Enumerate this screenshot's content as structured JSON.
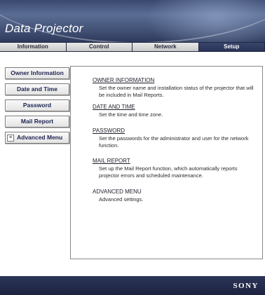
{
  "header": {
    "app_title": "Data Projector"
  },
  "tabs": [
    {
      "label": "Information"
    },
    {
      "label": "Control"
    },
    {
      "label": "Network"
    },
    {
      "label": "Setup"
    }
  ],
  "sidebar": {
    "items": [
      {
        "label": "Owner Information"
      },
      {
        "label": "Date and Time"
      },
      {
        "label": "Password"
      },
      {
        "label": "Mail Report"
      },
      {
        "label": "Advanced Menu",
        "icon": "collapse-icon",
        "icon_glyph": "≡"
      }
    ]
  },
  "main": {
    "sections": [
      {
        "title": "OWNER INFORMATION",
        "description": "Set the owner name and installation status of the projector that will be included in Mail Reports."
      },
      {
        "title": "DATE AND TIME",
        "description": "Set the time and time zone."
      },
      {
        "title": "PASSWORD",
        "description": "Set the passwords for the administrator and user for the network function."
      },
      {
        "title": "MAIL REPORT",
        "description": "Set up the Mail Report function, which automatically reports projector errors and scheduled maintenance."
      },
      {
        "title": "ADVANCED MENU",
        "description": "Advanced settings."
      }
    ]
  },
  "footer": {
    "brand": "SONY"
  },
  "colors": {
    "header_dark": "#2e3a5c",
    "active_tab": "#2a3458",
    "button_text": "#1c2350"
  }
}
